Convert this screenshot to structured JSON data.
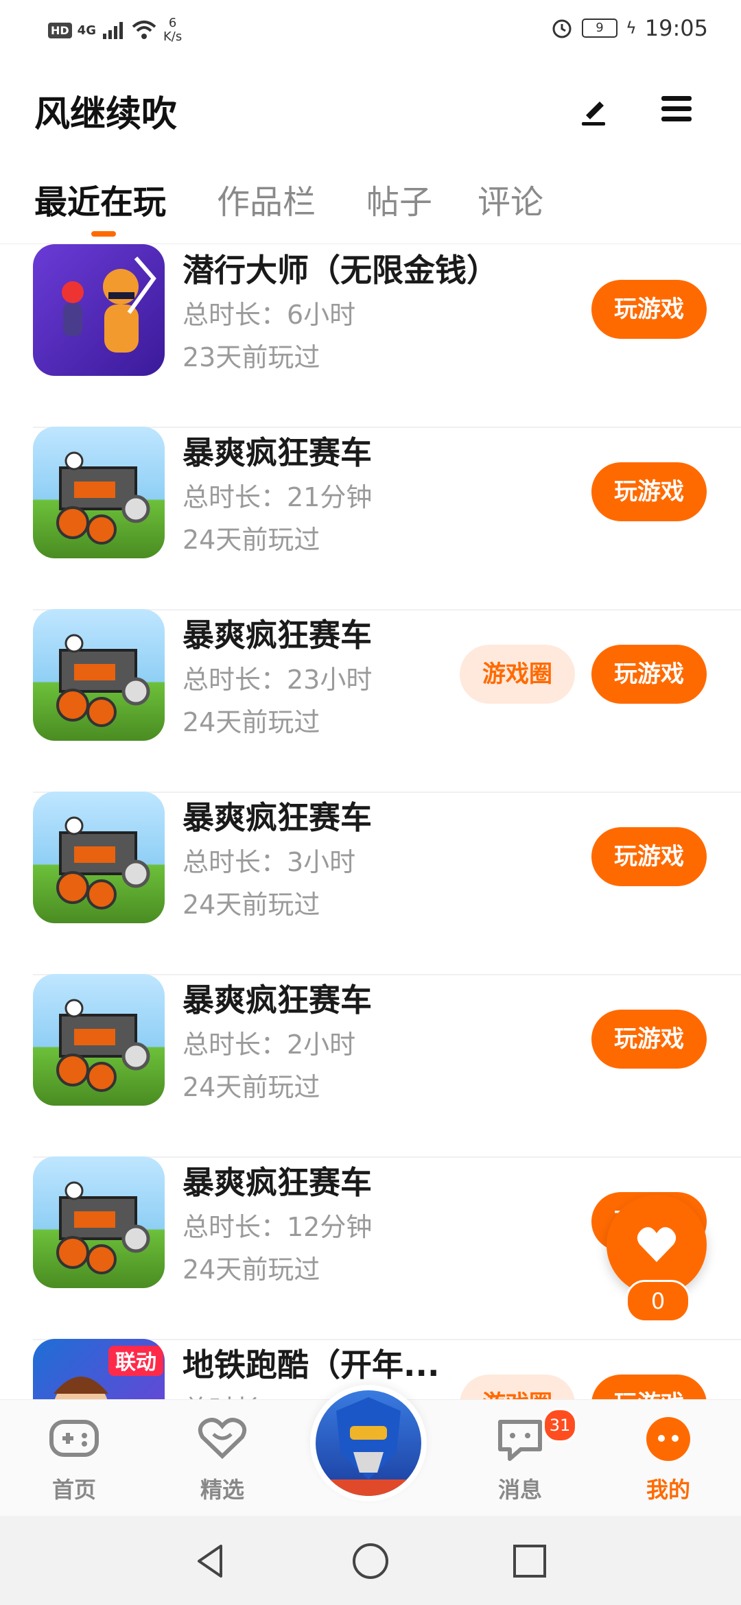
{
  "status_bar": {
    "hd": "HD",
    "network": "4G",
    "net_speed_value": "6",
    "net_speed_unit": "K/s",
    "battery": "9",
    "time": "19:05"
  },
  "header": {
    "title": "风继续吹",
    "edit_icon": "pen-icon",
    "menu_icon": "menu-icon"
  },
  "tabs": [
    {
      "label": "最近在玩",
      "active": true
    },
    {
      "label": "作品栏",
      "active": false
    },
    {
      "label": "帖子",
      "active": false
    },
    {
      "label": "评论",
      "active": false
    }
  ],
  "games": [
    {
      "title": "潜行大师（无限金钱）",
      "duration": "总时长：6小时",
      "last_played": "23天前玩过",
      "play_label": "玩游戏",
      "circle_label": ""
    },
    {
      "title": "暴爽疯狂赛车",
      "duration": "总时长：21分钟",
      "last_played": "24天前玩过",
      "play_label": "玩游戏",
      "circle_label": ""
    },
    {
      "title": "暴爽疯狂赛车",
      "duration": "总时长：23小时",
      "last_played": "24天前玩过",
      "play_label": "玩游戏",
      "circle_label": "游戏圈"
    },
    {
      "title": "暴爽疯狂赛车",
      "duration": "总时长：3小时",
      "last_played": "24天前玩过",
      "play_label": "玩游戏",
      "circle_label": ""
    },
    {
      "title": "暴爽疯狂赛车",
      "duration": "总时长：2小时",
      "last_played": "24天前玩过",
      "play_label": "玩游戏",
      "circle_label": ""
    },
    {
      "title": "暴爽疯狂赛车",
      "duration": "总时长：12分钟",
      "last_played": "24天前玩过",
      "play_label": "玩游戏",
      "circle_label": ""
    },
    {
      "title": "地铁跑酷（开年...",
      "duration": "总时长",
      "last_played": "",
      "play_label": "玩游戏",
      "circle_label": "游戏圈",
      "thumb_badge": "联动"
    }
  ],
  "float_like": {
    "count": "0",
    "icon": "heart-icon"
  },
  "bottom_nav": [
    {
      "label": "首页",
      "icon": "gamepad-icon",
      "active": false
    },
    {
      "label": "精选",
      "icon": "heart-chat-icon",
      "active": false
    },
    {
      "label": "",
      "icon": "avatar",
      "active": false
    },
    {
      "label": "消息",
      "icon": "message-icon",
      "active": false,
      "badge": "31"
    },
    {
      "label": "我的",
      "icon": "profile-face-icon",
      "active": true
    }
  ],
  "colors": {
    "accent": "#ff6a00",
    "accent_light": "#ffe9dc",
    "text_muted": "#9a9a9a"
  }
}
